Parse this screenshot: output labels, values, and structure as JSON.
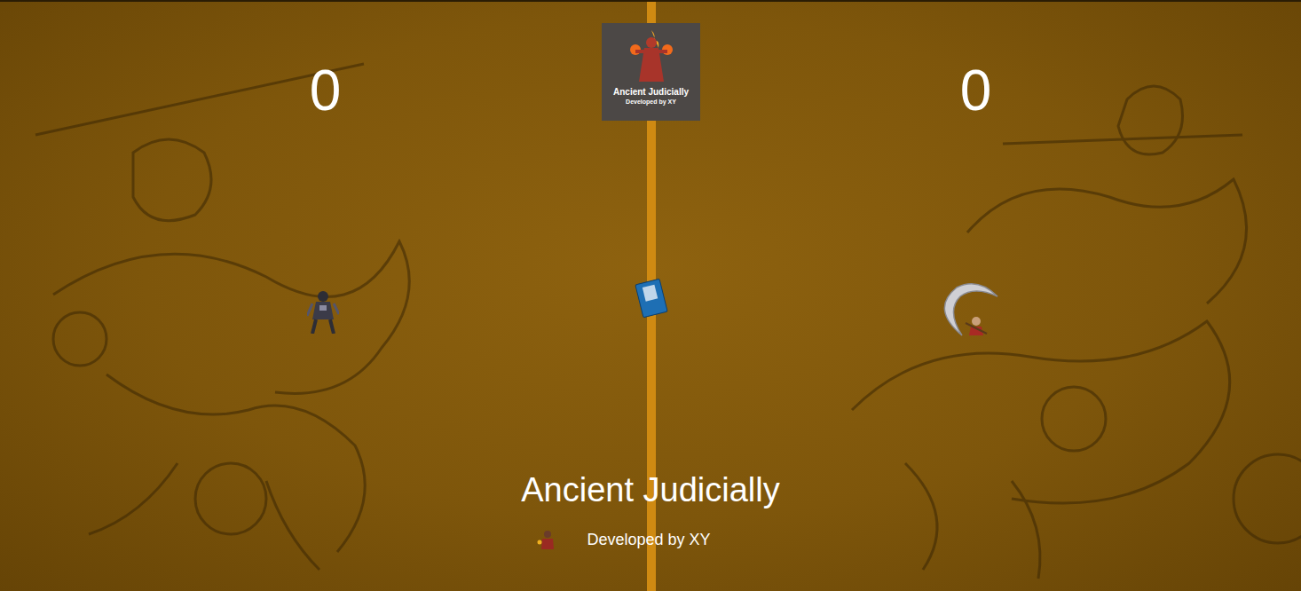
{
  "scores": [
    "0",
    "0"
  ],
  "logo": {
    "title": "Ancient Judicially",
    "subtitle": "Developed by XY"
  },
  "title": "Ancient Judicially",
  "credit": "Developed by XY"
}
